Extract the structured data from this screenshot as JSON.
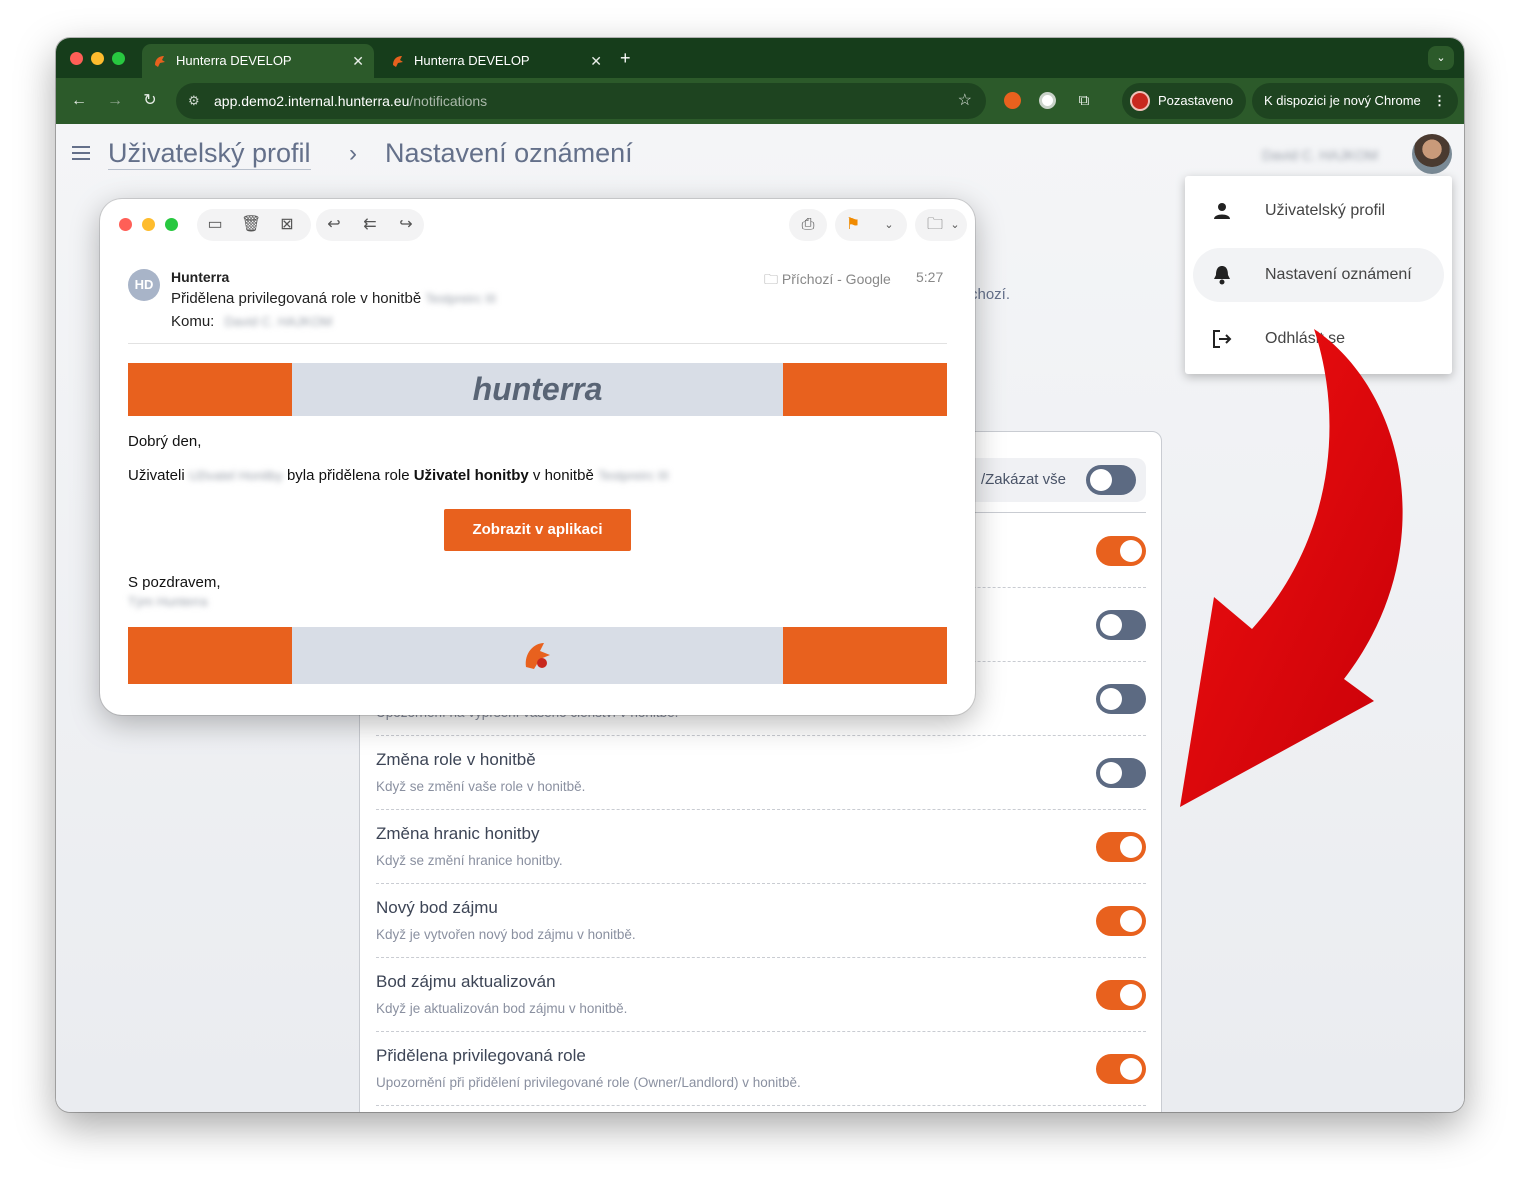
{
  "browser": {
    "tabs": [
      {
        "title": "Hunterra DEVELOP",
        "active": true
      },
      {
        "title": "Hunterra DEVELOP",
        "active": false
      }
    ],
    "url_domain": "app.demo2.internal.hunterra.eu",
    "url_path": "/notifications",
    "paused_label": "Pozastaveno",
    "update_label": "K dispozici je nový Chrome"
  },
  "header": {
    "crumb1": "Uživatelský profil",
    "crumb2": "Nastavení oznámení",
    "user_name": "David C. HAJKOM"
  },
  "menu": {
    "items": [
      {
        "label": "Uživatelský profil",
        "icon": "person-icon"
      },
      {
        "label": "Nastavení oznámení",
        "icon": "bell-icon",
        "selected": true
      },
      {
        "label": "Odhlásit se",
        "icon": "logout-icon"
      }
    ]
  },
  "page": {
    "partial_text": "chozí.",
    "toggle_all_label": "/Zakázat vše",
    "toggle_all_on": false
  },
  "notifications": [
    {
      "title": "",
      "desc": "",
      "on": true
    },
    {
      "title": "",
      "desc": "",
      "on": false
    },
    {
      "title": "",
      "desc": "Upozornění na vypršení vašeho členství v honitbě.",
      "on": false
    },
    {
      "title": "Změna role v honitbě",
      "desc": "Když se změní vaše role v honitbě.",
      "on": false
    },
    {
      "title": "Změna hranic honitby",
      "desc": "Když se změní hranice honitby.",
      "on": true
    },
    {
      "title": "Nový bod zájmu",
      "desc": "Když je vytvořen nový bod zájmu v honitbě.",
      "on": true
    },
    {
      "title": "Bod zájmu aktualizován",
      "desc": "Když je aktualizován bod zájmu v honitbě.",
      "on": true
    },
    {
      "title": "Přidělena privilegovaná role",
      "desc": "Upozornění při přidělení privilegované role (Owner/Landlord) v honitbě.",
      "on": true
    }
  ],
  "email": {
    "avatar": "HD",
    "from": "Hunterra",
    "subject": "Přidělena privilegovaná role v honitbě",
    "subject_blur": "Testpreirc III",
    "to_label": "Komu:",
    "to_blur": "David C. HAJKOM",
    "folder": "Příchozí - Google",
    "time": "5:27",
    "logo": "hunterra",
    "greeting": "Dobrý den,",
    "body_prefix": "Uživateli",
    "body_user_blur": "Uživatel Honitby",
    "body_mid": "byla přidělena role",
    "body_role": "Uživatel honitby",
    "body_suffix": "v honitbě",
    "body_hunt_blur": "Testpreirc III",
    "button": "Zobrazit v aplikaci",
    "closing": "S pozdravem,",
    "signature_blur": "Tým Hunterra"
  },
  "colors": {
    "brand_orange": "#e8611e",
    "chrome_green": "#2c5a2a",
    "arrow_red": "#e8000a"
  }
}
